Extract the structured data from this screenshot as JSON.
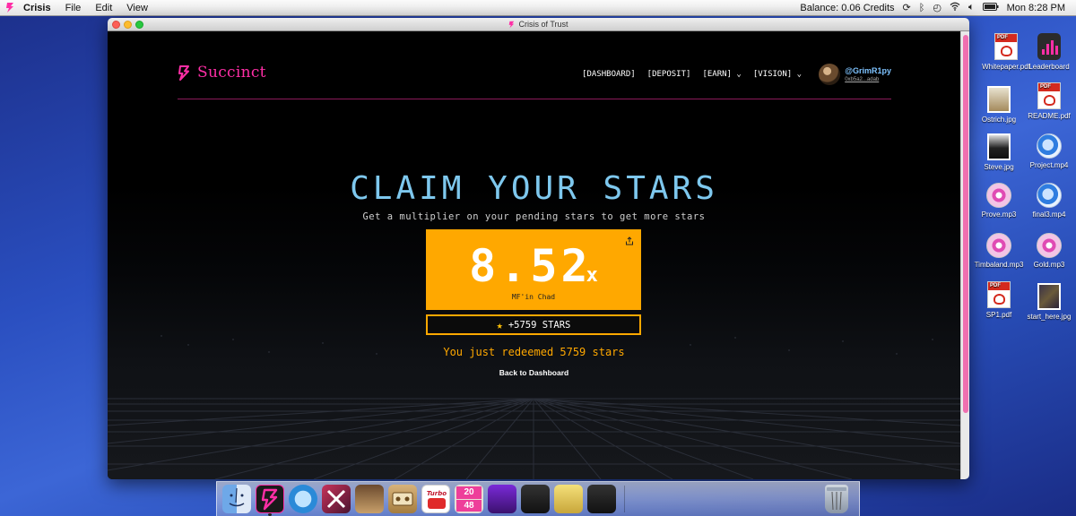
{
  "menubar": {
    "app_name": "Crisis",
    "menus": [
      "File",
      "Edit",
      "View"
    ],
    "balance": "Balance:  0.06 Credits",
    "clock": "Mon 8:28 PM"
  },
  "window": {
    "title": "Crisis of Trust"
  },
  "site": {
    "brand": "Succinct",
    "nav": [
      "[DASHBOARD]",
      "[DEPOSIT]",
      "[EARN] ⌄",
      "[VISION] ⌄"
    ],
    "user_name": "@GrimR1py",
    "user_address": "0xb5a2...adab"
  },
  "hero": {
    "title": "CLAIM YOUR STARS",
    "subtitle": "Get a multiplier on your pending stars to get more stars",
    "multiplier_value": "8.52",
    "multiplier_suffix": "x",
    "multiplier_label": "MF'in Chad",
    "stars_button": "+5759 STARS",
    "redeemed_text": "You just redeemed 5759 stars",
    "back_link": "Back to Dashboard"
  },
  "desktop": {
    "icons": [
      {
        "label": "Whitepaper.pdf",
        "type": "pdf"
      },
      {
        "label": "Leaderboard",
        "type": "app"
      },
      {
        "label": "Ostrich.jpg",
        "type": "image"
      },
      {
        "label": "README.pdf",
        "type": "pdf"
      },
      {
        "label": "Steve.jpg",
        "type": "image"
      },
      {
        "label": "Project.mp4",
        "type": "video"
      },
      {
        "label": "Prove.mp3",
        "type": "audio"
      },
      {
        "label": "final3.mp4",
        "type": "video"
      },
      {
        "label": "Timbaland.mp3",
        "type": "audio"
      },
      {
        "label": "Gold.mp3",
        "type": "audio"
      },
      {
        "label": "SP1.pdf",
        "type": "pdf"
      },
      {
        "label": "start_here.jpg",
        "type": "image"
      }
    ]
  },
  "dock": {
    "tile_2048": [
      "20",
      "48"
    ],
    "turbo_label": "Turbo"
  },
  "colors": {
    "brand_pink": "#ff2ea6",
    "title_cyan": "#7ec8ee",
    "card_orange": "#ffa800",
    "desktop_blue": "#2a4fc0"
  }
}
